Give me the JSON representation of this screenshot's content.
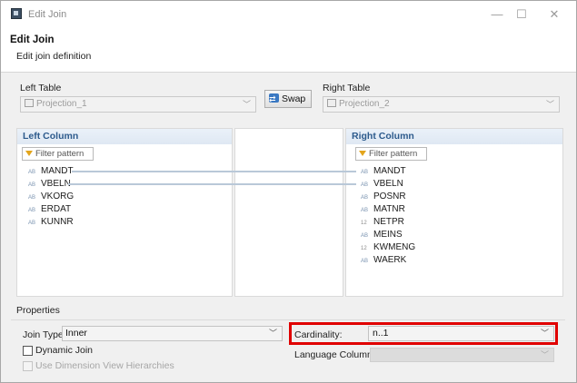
{
  "window": {
    "title": "Edit Join",
    "minimize_glyph": "—",
    "maximize_glyph": "☐",
    "close_glyph": "✕"
  },
  "header": {
    "title": "Edit Join",
    "subtitle": "Edit join definition"
  },
  "left_table": {
    "label": "Left Table",
    "value": "Projection_1"
  },
  "swap_button": {
    "label": "Swap",
    "icon": "swap-icon"
  },
  "right_table": {
    "label": "Right Table",
    "value": "Projection_2"
  },
  "left_column": {
    "header": "Left Column",
    "filter_placeholder": "Filter pattern",
    "items": [
      {
        "name": "MANDT",
        "type_icon": "AB"
      },
      {
        "name": "VBELN",
        "type_icon": "AB"
      },
      {
        "name": "VKORG",
        "type_icon": "AB"
      },
      {
        "name": "ERDAT",
        "type_icon": "AB"
      },
      {
        "name": "KUNNR",
        "type_icon": "AB"
      }
    ]
  },
  "right_column": {
    "header": "Right Column",
    "filter_placeholder": "Filter pattern",
    "items": [
      {
        "name": "MANDT",
        "type_icon": "AB"
      },
      {
        "name": "VBELN",
        "type_icon": "AB"
      },
      {
        "name": "POSNR",
        "type_icon": "AB"
      },
      {
        "name": "MATNR",
        "type_icon": "AB"
      },
      {
        "name": "NETPR",
        "type_icon": "12"
      },
      {
        "name": "MEINS",
        "type_icon": "AB"
      },
      {
        "name": "KWMENG",
        "type_icon": "12"
      },
      {
        "name": "WAERK",
        "type_icon": "AB"
      }
    ]
  },
  "mappings": [
    {
      "left": "MANDT",
      "right": "MANDT"
    },
    {
      "left": "VBELN",
      "right": "VBELN"
    }
  ],
  "properties": {
    "section_label": "Properties",
    "join_type_label": "Join Type:",
    "join_type_value": "Inner",
    "dynamic_join_label": "Dynamic Join",
    "dynamic_join_checked": false,
    "use_dim_hier_label": "Use Dimension View Hierarchies",
    "use_dim_hier_checked": false,
    "cardinality_label": "Cardinality:",
    "cardinality_value": "n..1",
    "language_column_label": "Language Column:",
    "language_column_value": ""
  },
  "colors": {
    "highlight": "#e00000",
    "panel_header_text": "#2c5a8c",
    "mapping_line": "#b9c8d8"
  }
}
